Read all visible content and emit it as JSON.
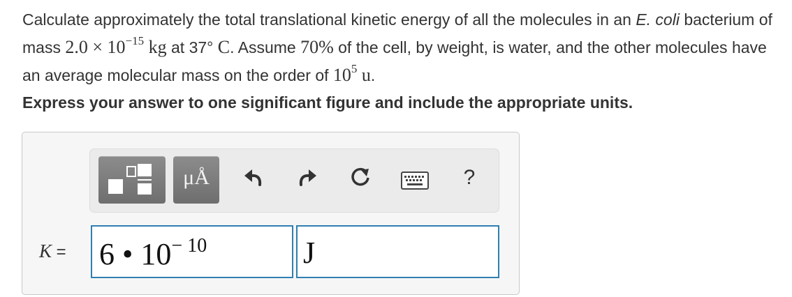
{
  "problem": {
    "s1": "Calculate approximately the total translational kinetic energy of all the molecules in an ",
    "organism": "E. coli",
    "s2": " bacterium of mass ",
    "mass_coef": "2.0 × 10",
    "mass_exp": "−15",
    "mass_unit": " kg",
    "s3": " at 37° ",
    "temp_unit": "C",
    "s4": ". Assume ",
    "pct": "70%",
    "s5": " of the cell, by weight, is water, and the other molecules have an average molecular mass on the order of ",
    "mm_base": "10",
    "mm_exp": "5",
    "mm_unit": " u",
    "s6": "."
  },
  "instruction": "Express your answer to one significant figure and include the appropriate units.",
  "toolbar": {
    "units_button": "μÅ",
    "help_label": "?",
    "icons": [
      "templates-icon",
      "undo-icon",
      "redo-icon",
      "reset-icon",
      "keyboard-icon",
      "help-icon"
    ]
  },
  "answer": {
    "label_var": "K",
    "label_eq": " = ",
    "value_main": "6 • 10",
    "value_exp": "− 10",
    "unit": "J"
  },
  "colors": {
    "field_border": "#2f80b2",
    "button_gray": "#7d7d7d",
    "text": "#333333"
  }
}
